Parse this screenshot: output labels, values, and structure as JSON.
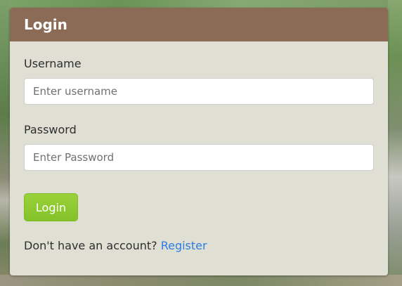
{
  "header": {
    "title": "Login"
  },
  "form": {
    "username": {
      "label": "Username",
      "placeholder": "Enter username",
      "value": ""
    },
    "password": {
      "label": "Password",
      "placeholder": "Enter Password",
      "value": ""
    },
    "submit_label": "Login"
  },
  "footer": {
    "prompt": "Don't have an account?",
    "register_link": "Register"
  },
  "colors": {
    "header_bg": "#8b6b55",
    "card_bg": "#e0dfd4",
    "button_green": "#8dc832",
    "link_blue": "#2b7de3"
  }
}
